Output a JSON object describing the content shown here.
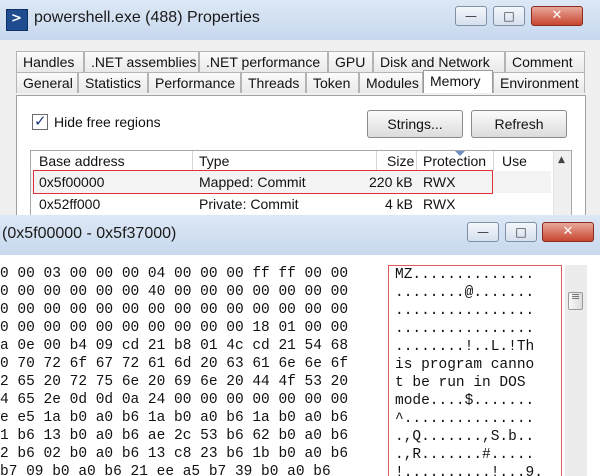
{
  "properties_window": {
    "title": "powershell.exe (488) Properties",
    "caption_buttons": {
      "minimize": "—",
      "maximize": "□",
      "close": "✕"
    },
    "tabs_row1": [
      "Handles",
      ".NET assemblies",
      ".NET performance",
      "GPU",
      "Disk and Network",
      "Comment"
    ],
    "tabs_row2": [
      "General",
      "Statistics",
      "Performance",
      "Threads",
      "Token",
      "Modules",
      "Memory",
      "Environment"
    ],
    "active_tab": "Memory",
    "hide_free_regions": {
      "label": "Hide free regions",
      "checked": true
    },
    "buttons": {
      "strings": "Strings...",
      "refresh": "Refresh"
    },
    "list": {
      "columns": [
        "Base address",
        "Type",
        "Size",
        "Protection",
        "Use"
      ],
      "rows": [
        {
          "base": "0x5f00000",
          "type": "Mapped: Commit",
          "size": "220 kB",
          "protection": "RWX",
          "use": ""
        },
        {
          "base": "0x52ff000",
          "type": "Private: Commit",
          "size": "4 kB",
          "protection": "RWX",
          "use": ""
        }
      ]
    },
    "colors": {
      "highlight_border": "#e0303a",
      "title_gradient_top": "#dde8f5"
    }
  },
  "memory_window": {
    "title": "(0x5f00000 - 0x5f37000)",
    "hex_lines": [
      "0 00 03 00 00 00 04 00 00 00 ff ff 00 00",
      "0 00 00 00 00 00 40 00 00 00 00 00 00 00",
      "0 00 00 00 00 00 00 00 00 00 00 00 00 00",
      "0 00 00 00 00 00 00 00 00 00 18 01 00 00",
      "a 0e 00 b4 09 cd 21 b8 01 4c cd 21 54 68",
      "0 70 72 6f 67 72 61 6d 20 63 61 6e 6e 6f",
      "2 65 20 72 75 6e 20 69 6e 20 44 4f 53 20",
      "4 65 2e 0d 0d 0a 24 00 00 00 00 00 00 00",
      "e e5 1a b0 a0 b6 1a b0 a0 b6 1a b0 a0 b6",
      "1 b6 13 b0 a0 b6 ae 2c 53 b6 62 b0 a0 b6",
      "2 b6 02 b0 a0 b6 13 c8 23 b6 1b b0 a0 b6",
      "b7 09 b0 a0 b6 21 ee a5 b7 39 b0 a0 b6"
    ],
    "ascii_lines": [
      "MZ..............",
      "........@.......",
      "................",
      "................",
      "........!..L.!Th",
      "is program canno",
      "t be run in DOS ",
      "mode....$.......",
      "^...............",
      ".,Q.......,S.b..",
      ".,R.......#.....",
      "!..........!...9."
    ]
  }
}
